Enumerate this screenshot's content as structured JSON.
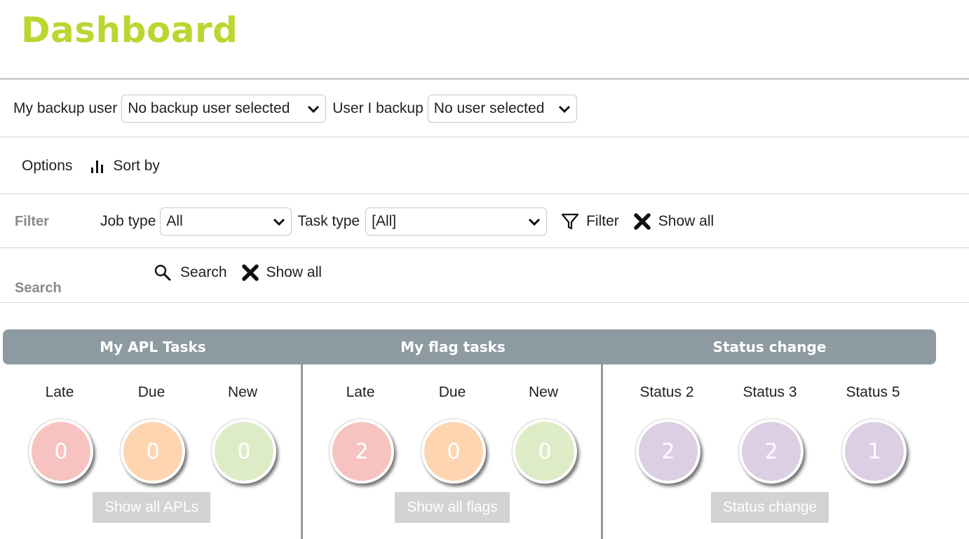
{
  "page": {
    "title": "Dashboard"
  },
  "backup": {
    "my_backup_label": "My backup user",
    "my_backup_value": "No backup user selected",
    "user_i_backup_label": "User I backup",
    "user_i_backup_value": "No user selected"
  },
  "options": {
    "label": "Options",
    "sort_label": "Sort by"
  },
  "filter": {
    "section_label": "Filter",
    "job_type_label": "Job type",
    "job_type_value": "All",
    "task_type_label": "Task type",
    "task_type_value": "[All]",
    "filter_button": "Filter",
    "show_all_button": "Show all"
  },
  "search": {
    "section_label": "Search",
    "search_button": "Search",
    "show_all_button": "Show all"
  },
  "panels": [
    {
      "title": "My APL Tasks",
      "items": [
        {
          "label": "Late",
          "count": "0",
          "color": "#f7c3c0"
        },
        {
          "label": "Due",
          "count": "0",
          "color": "#fdd5b1"
        },
        {
          "label": "New",
          "count": "0",
          "color": "#ddecc6"
        }
      ],
      "button": "Show all APLs"
    },
    {
      "title": "My flag tasks",
      "items": [
        {
          "label": "Late",
          "count": "2",
          "color": "#f7c3c0"
        },
        {
          "label": "Due",
          "count": "0",
          "color": "#fdd5b1"
        },
        {
          "label": "New",
          "count": "0",
          "color": "#ddecc6"
        }
      ],
      "button": "Show all flags"
    },
    {
      "title": "Status change",
      "items": [
        {
          "label": "Status 2",
          "count": "2",
          "color": "#dccfe3"
        },
        {
          "label": "Status 3",
          "count": "2",
          "color": "#dccfe3"
        },
        {
          "label": "Status 5",
          "count": "1",
          "color": "#dccfe3"
        }
      ],
      "button": "Status change"
    }
  ],
  "icons": {
    "chevron": "chevron-down-icon",
    "sort": "bar-chart-icon",
    "filter": "funnel-icon",
    "clear": "x-icon",
    "search": "magnifier-icon"
  }
}
